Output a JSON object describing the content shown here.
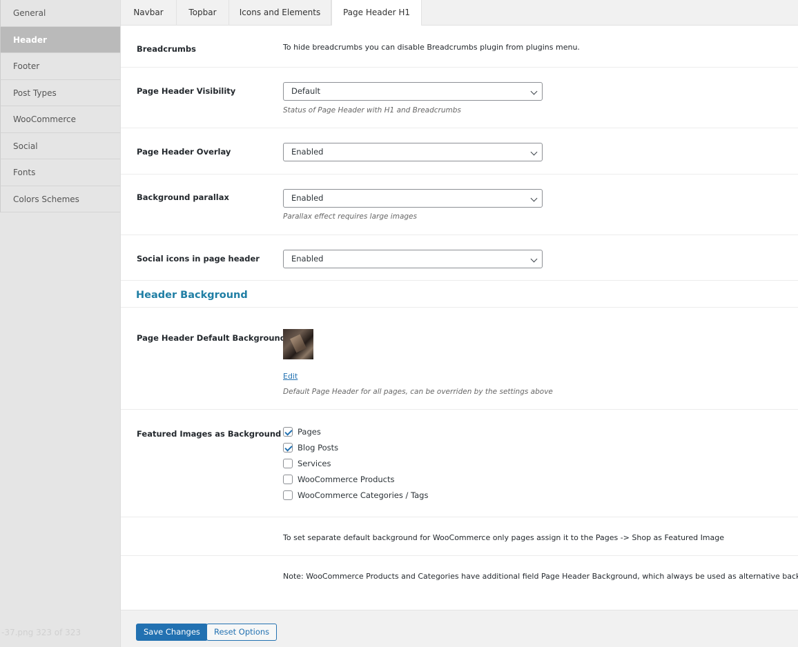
{
  "sidebar": {
    "items": [
      {
        "label": "General"
      },
      {
        "label": "Header"
      },
      {
        "label": "Footer"
      },
      {
        "label": "Post Types"
      },
      {
        "label": "WooCommerce"
      },
      {
        "label": "Social"
      },
      {
        "label": "Fonts"
      },
      {
        "label": "Colors Schemes"
      }
    ],
    "active_index": 1,
    "footer_text": "-37.png 323 of 323"
  },
  "tabs": [
    {
      "label": "Navbar"
    },
    {
      "label": "Topbar"
    },
    {
      "label": "Icons and Elements"
    },
    {
      "label": "Page Header H1",
      "active": true
    }
  ],
  "settings": {
    "breadcrumbs": {
      "label": "Breadcrumbs",
      "note": "To hide breadcrumbs you can disable Breadcrumbs plugin from plugins menu."
    },
    "page_header_visibility": {
      "label": "Page Header Visibility",
      "value": "Default",
      "desc": "Status of Page Header with H1 and Breadcrumbs"
    },
    "page_header_overlay": {
      "label": "Page Header Overlay",
      "value": "Enabled"
    },
    "background_parallax": {
      "label": "Background parallax",
      "value": "Enabled",
      "desc": "Parallax effect requires large images"
    },
    "social_icons": {
      "label": "Social icons in page header",
      "value": "Enabled"
    }
  },
  "header_background": {
    "title": "Header Background",
    "default_background": {
      "label": "Page Header Default Background",
      "edit_label": "Edit",
      "desc": "Default Page Header for all pages, can be overriden by the settings above"
    },
    "featured_images": {
      "label": "Featured Images as Background",
      "options": [
        {
          "label": "Pages",
          "checked": true
        },
        {
          "label": "Blog Posts",
          "checked": true
        },
        {
          "label": "Services",
          "checked": false
        },
        {
          "label": "WooCommerce Products",
          "checked": false
        },
        {
          "label": "WooCommerce Categories / Tags",
          "checked": false
        }
      ]
    },
    "note_woo_shop": "To set separate default background for WooCommerce only pages assign it to the Pages -> Shop as Featured Image",
    "note_woo_products": "Note: WooCommerce Products and Categories have additional field Page Header Background, which always be used as alternative background"
  },
  "footer": {
    "save_label": "Save Changes",
    "reset_label": "Reset Options"
  },
  "colors": {
    "accent": "#2271b1",
    "section_title": "#1f7ea4",
    "sidebar_active": "#bababa"
  }
}
